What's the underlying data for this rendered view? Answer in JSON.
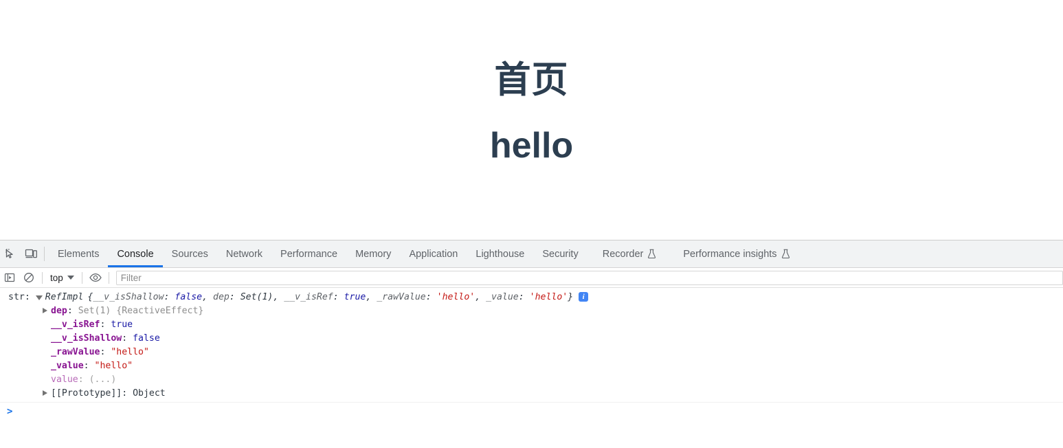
{
  "page": {
    "title": "首页",
    "subtitle": "hello",
    "heading_color": "#2c3e50"
  },
  "devtools": {
    "toolbar_icons": [
      {
        "name": "inspect-element-icon",
        "tooltip": "Inspect"
      },
      {
        "name": "device-toolbar-icon",
        "tooltip": "Toggle device toolbar"
      }
    ],
    "tabs": [
      {
        "label": "Elements",
        "active": false,
        "experimental": false
      },
      {
        "label": "Console",
        "active": true,
        "experimental": false
      },
      {
        "label": "Sources",
        "active": false,
        "experimental": false
      },
      {
        "label": "Network",
        "active": false,
        "experimental": false
      },
      {
        "label": "Performance",
        "active": false,
        "experimental": false
      },
      {
        "label": "Memory",
        "active": false,
        "experimental": false
      },
      {
        "label": "Application",
        "active": false,
        "experimental": false
      },
      {
        "label": "Lighthouse",
        "active": false,
        "experimental": false
      },
      {
        "label": "Security",
        "active": false,
        "experimental": false
      },
      {
        "label": "Recorder",
        "active": false,
        "experimental": true
      },
      {
        "label": "Performance insights",
        "active": false,
        "experimental": true
      }
    ],
    "active_tab_underline_color": "#1a73e8",
    "filterbar": {
      "sidebar_toggle_icon": "console-sidebar-icon",
      "clear_console_icon": "clear-console-icon",
      "context": "top",
      "eye_icon": "live-expression-eye-icon",
      "filter_placeholder": "Filter",
      "filter_value": ""
    },
    "console": {
      "label": "str:",
      "preview": {
        "constructor": "RefImpl",
        "open_brace": "{",
        "entries": [
          {
            "key": "__v_isShallow",
            "sep": ": ",
            "value": "false",
            "kind": "bool"
          },
          {
            "key": "dep",
            "sep": ": ",
            "value": "Set(1)",
            "kind": "obj"
          },
          {
            "key": "__v_isRef",
            "sep": ": ",
            "value": "true",
            "kind": "bool"
          },
          {
            "key": "_rawValue",
            "sep": ": ",
            "value": "'hello'",
            "kind": "str"
          },
          {
            "key": "_value",
            "sep": ": ",
            "value": "'hello'",
            "kind": "str"
          }
        ],
        "close_brace": "}",
        "info_badge": "i"
      },
      "properties": [
        {
          "expandable": true,
          "key": "dep",
          "sep": ": ",
          "value": "Set(1) {ReactiveEffect}",
          "kind": "set",
          "readonly": false
        },
        {
          "expandable": false,
          "key": "__v_isRef",
          "sep": ": ",
          "value": "true",
          "kind": "bool",
          "readonly": false
        },
        {
          "expandable": false,
          "key": "__v_isShallow",
          "sep": ": ",
          "value": "false",
          "kind": "bool",
          "readonly": false
        },
        {
          "expandable": false,
          "key": "_rawValue",
          "sep": ": ",
          "value": "\"hello\"",
          "kind": "str",
          "readonly": false
        },
        {
          "expandable": false,
          "key": "_value",
          "sep": ": ",
          "value": "\"hello\"",
          "kind": "str",
          "readonly": false
        },
        {
          "expandable": false,
          "key": "value",
          "sep": ": ",
          "value": "(...)",
          "kind": "dim",
          "readonly": true
        },
        {
          "expandable": true,
          "key": "[[Prototype]]",
          "sep": ": ",
          "value": "Object",
          "kind": "proto",
          "readonly": false
        }
      ],
      "prompt_chevron": ">",
      "prompt_value": ""
    }
  }
}
